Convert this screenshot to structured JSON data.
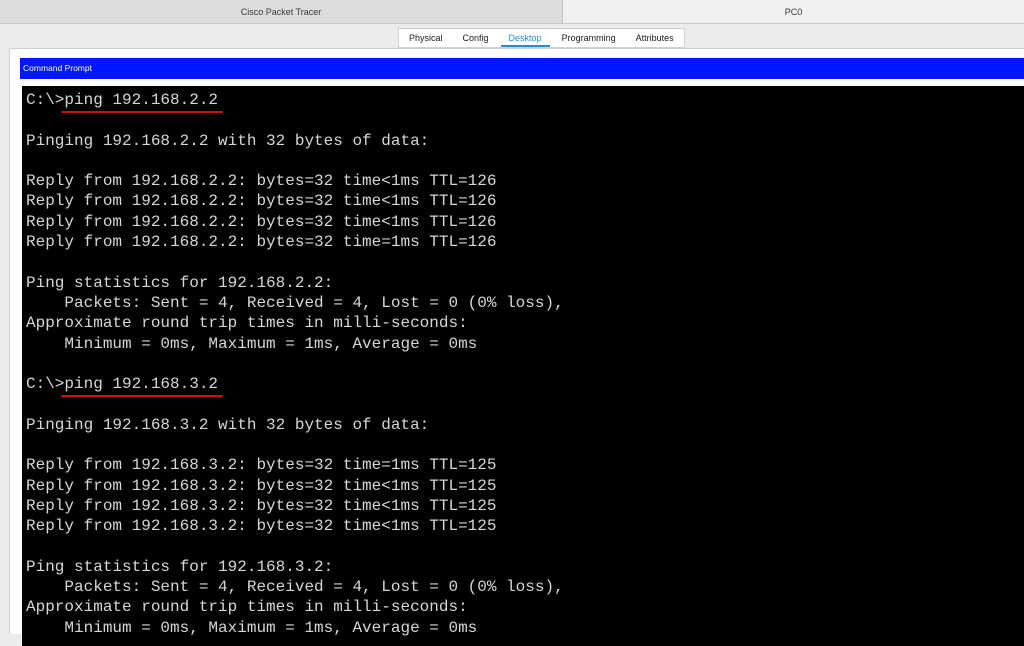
{
  "window": {
    "tabs": [
      "Cisco Packet Tracer",
      "PC0"
    ]
  },
  "device_tabs": [
    "Physical",
    "Config",
    "Desktop",
    "Programming",
    "Attributes"
  ],
  "selected_tab": "Desktop",
  "command_prompt": {
    "title": "Command Prompt",
    "prompt": "C:\\>",
    "lines": [
      {
        "type": "command",
        "text": "ping 192.168.2.2"
      },
      {
        "type": "blank",
        "text": ""
      },
      {
        "type": "output",
        "text": "Pinging 192.168.2.2 with 32 bytes of data:"
      },
      {
        "type": "blank",
        "text": ""
      },
      {
        "type": "output",
        "text": "Reply from 192.168.2.2: bytes=32 time<1ms TTL=126"
      },
      {
        "type": "output",
        "text": "Reply from 192.168.2.2: bytes=32 time<1ms TTL=126"
      },
      {
        "type": "output",
        "text": "Reply from 192.168.2.2: bytes=32 time<1ms TTL=126"
      },
      {
        "type": "output",
        "text": "Reply from 192.168.2.2: bytes=32 time=1ms TTL=126"
      },
      {
        "type": "blank",
        "text": ""
      },
      {
        "type": "output",
        "text": "Ping statistics for 192.168.2.2:"
      },
      {
        "type": "output",
        "text": "    Packets: Sent = 4, Received = 4, Lost = 0 (0% loss),"
      },
      {
        "type": "output",
        "text": "Approximate round trip times in milli-seconds:"
      },
      {
        "type": "output",
        "text": "    Minimum = 0ms, Maximum = 1ms, Average = 0ms"
      },
      {
        "type": "blank",
        "text": ""
      },
      {
        "type": "command",
        "text": "ping 192.168.3.2"
      },
      {
        "type": "blank",
        "text": ""
      },
      {
        "type": "output",
        "text": "Pinging 192.168.3.2 with 32 bytes of data:"
      },
      {
        "type": "blank",
        "text": ""
      },
      {
        "type": "output",
        "text": "Reply from 192.168.3.2: bytes=32 time=1ms TTL=125"
      },
      {
        "type": "output",
        "text": "Reply from 192.168.3.2: bytes=32 time<1ms TTL=125"
      },
      {
        "type": "output",
        "text": "Reply from 192.168.3.2: bytes=32 time<1ms TTL=125"
      },
      {
        "type": "output",
        "text": "Reply from 192.168.3.2: bytes=32 time<1ms TTL=125"
      },
      {
        "type": "blank",
        "text": ""
      },
      {
        "type": "output",
        "text": "Ping statistics for 192.168.3.2:"
      },
      {
        "type": "output",
        "text": "    Packets: Sent = 4, Received = 4, Lost = 0 (0% loss),"
      },
      {
        "type": "output",
        "text": "Approximate round trip times in milli-seconds:"
      },
      {
        "type": "output",
        "text": "    Minimum = 0ms, Maximum = 1ms, Average = 0ms"
      }
    ]
  },
  "colors": {
    "title_bar": "#0017ff",
    "terminal_bg": "#000000",
    "terminal_text": "#d6d6d6",
    "selected_tab": "#2a8bd4",
    "command_underline": "#c41414"
  }
}
